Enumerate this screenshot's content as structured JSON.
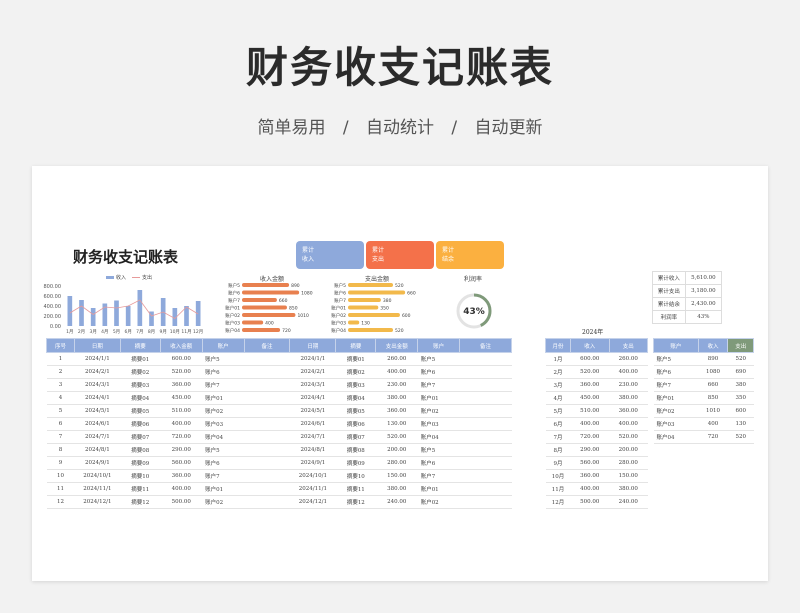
{
  "hero": {
    "title": "财务收支记账表",
    "sub": [
      "简单易用",
      "/",
      "自动统计",
      "/",
      "自动更新"
    ]
  },
  "sheet": {
    "title": "财务收支记账表",
    "cards": [
      {
        "l1": "累计",
        "l2": "收入",
        "color": "#8ea9db"
      },
      {
        "l1": "累计",
        "l2": "支出",
        "color": "#f4714a"
      },
      {
        "l1": "累计",
        "l2": "结余",
        "color": "#fbb040"
      }
    ],
    "summary": [
      [
        "累计收入",
        "5,610.00"
      ],
      [
        "累计支出",
        "3,180.00"
      ],
      [
        "累计结余",
        "2,430.00"
      ],
      [
        "利润率",
        "43%"
      ]
    ]
  },
  "chart_data": [
    {
      "type": "bar",
      "legend": [
        "收入",
        "支出"
      ],
      "categories": [
        "1月",
        "2月",
        "3月",
        "4月",
        "5月",
        "6月",
        "7月",
        "8月",
        "9月",
        "10月",
        "11月",
        "12月"
      ],
      "yticks": [
        "800.00",
        "600.00",
        "400.00",
        "200.00",
        "0.00"
      ],
      "ylim": [
        0,
        800
      ],
      "series": [
        {
          "name": "收入",
          "values": [
            600,
            520,
            360,
            450,
            510,
            400,
            720,
            290,
            560,
            360,
            400,
            500
          ]
        },
        {
          "name": "支出",
          "values": [
            260,
            400,
            230,
            380,
            360,
            400,
            520,
            200,
            280,
            150,
            380,
            240
          ]
        }
      ]
    },
    {
      "type": "bar",
      "title": "收入金额",
      "categories": [
        "账户5",
        "账户6",
        "账户7",
        "账户01",
        "账户02",
        "账户03",
        "账户04"
      ],
      "values": [
        890,
        1080,
        660,
        850,
        1010,
        400,
        720
      ],
      "color": "#e8804f"
    },
    {
      "type": "bar",
      "title": "支出金额",
      "categories": [
        "账户5",
        "账户6",
        "账户7",
        "账户01",
        "账户02",
        "账户03",
        "账户04"
      ],
      "values": [
        520,
        660,
        380,
        350,
        600,
        130,
        520
      ],
      "color": "#f2b94b"
    },
    {
      "type": "pie",
      "title": "利润率",
      "label": "43%",
      "value": 43
    }
  ],
  "main_table": {
    "headers": [
      "序号",
      "日期",
      "摘要",
      "收入金额",
      "账户",
      "备注",
      "日期",
      "摘要",
      "支出金额",
      "账户",
      "备注"
    ],
    "rows": [
      [
        "1",
        "2024/1/1",
        "摘要01",
        "600.00",
        "账户5",
        "",
        "2024/1/1",
        "摘要01",
        "260.00",
        "账户5",
        ""
      ],
      [
        "2",
        "2024/2/1",
        "摘要02",
        "520.00",
        "账户6",
        "",
        "2024/2/1",
        "摘要02",
        "400.00",
        "账户6",
        ""
      ],
      [
        "3",
        "2024/3/1",
        "摘要03",
        "360.00",
        "账户7",
        "",
        "2024/3/1",
        "摘要03",
        "230.00",
        "账户7",
        ""
      ],
      [
        "4",
        "2024/4/1",
        "摘要04",
        "450.00",
        "账户01",
        "",
        "2024/4/1",
        "摘要04",
        "380.00",
        "账户01",
        ""
      ],
      [
        "5",
        "2024/5/1",
        "摘要05",
        "510.00",
        "账户02",
        "",
        "2024/5/1",
        "摘要05",
        "360.00",
        "账户02",
        ""
      ],
      [
        "6",
        "2024/6/1",
        "摘要06",
        "400.00",
        "账户03",
        "",
        "2024/6/1",
        "摘要06",
        "130.00",
        "账户03",
        ""
      ],
      [
        "7",
        "2024/7/1",
        "摘要07",
        "720.00",
        "账户04",
        "",
        "2024/7/1",
        "摘要07",
        "520.00",
        "账户04",
        ""
      ],
      [
        "8",
        "2024/8/1",
        "摘要08",
        "290.00",
        "账户5",
        "",
        "2024/8/1",
        "摘要08",
        "200.00",
        "账户5",
        ""
      ],
      [
        "9",
        "2024/9/1",
        "摘要09",
        "560.00",
        "账户6",
        "",
        "2024/9/1",
        "摘要09",
        "280.00",
        "账户6",
        ""
      ],
      [
        "10",
        "2024/10/1",
        "摘要10",
        "360.00",
        "账户7",
        "",
        "2024/10/1",
        "摘要10",
        "150.00",
        "账户7",
        ""
      ],
      [
        "11",
        "2024/11/1",
        "摘要11",
        "400.00",
        "账户01",
        "",
        "2024/11/1",
        "摘要11",
        "380.00",
        "账户01",
        ""
      ],
      [
        "12",
        "2024/12/1",
        "摘要12",
        "500.00",
        "账户02",
        "",
        "2024/12/1",
        "摘要12",
        "240.00",
        "账户02",
        ""
      ]
    ]
  },
  "month_table": {
    "year_label": "2024年",
    "headers": [
      "月份",
      "收入",
      "支出"
    ],
    "rows": [
      [
        "1月",
        "600.00",
        "260.00"
      ],
      [
        "2月",
        "520.00",
        "400.00"
      ],
      [
        "3月",
        "360.00",
        "230.00"
      ],
      [
        "4月",
        "450.00",
        "380.00"
      ],
      [
        "5月",
        "510.00",
        "360.00"
      ],
      [
        "6月",
        "400.00",
        "400.00"
      ],
      [
        "7月",
        "720.00",
        "520.00"
      ],
      [
        "8月",
        "290.00",
        "200.00"
      ],
      [
        "9月",
        "560.00",
        "280.00"
      ],
      [
        "10月",
        "360.00",
        "150.00"
      ],
      [
        "11月",
        "400.00",
        "380.00"
      ],
      [
        "12月",
        "500.00",
        "240.00"
      ]
    ]
  },
  "account_table": {
    "headers": [
      "账户",
      "收入",
      "支出"
    ],
    "rows": [
      [
        "账户5",
        "890",
        "520"
      ],
      [
        "账户6",
        "1080",
        "690"
      ],
      [
        "账户7",
        "660",
        "380"
      ],
      [
        "账户01",
        "850",
        "350"
      ],
      [
        "账户02",
        "1010",
        "600"
      ],
      [
        "账户03",
        "400",
        "130"
      ],
      [
        "账户04",
        "720",
        "520"
      ]
    ]
  }
}
